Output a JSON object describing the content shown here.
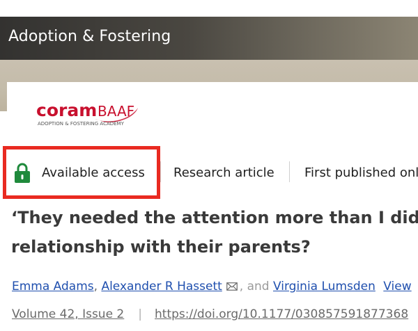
{
  "journal": {
    "title": "Adoption & Fostering"
  },
  "logo": {
    "brand_main": "coram",
    "brand_suffix": "BAAF",
    "tagline": "ADOPTION & FOSTERING ACADEMY"
  },
  "article_meta": {
    "access_label": "Available access",
    "article_type": "Research article",
    "first_published": "First published onl"
  },
  "article": {
    "title_line1": "‘They needed the attention more than I did’:",
    "title_line2": "relationship with their parents?"
  },
  "authors": {
    "author1": "Emma Adams",
    "author2": "Alexander R Hassett",
    "and_text": ", and",
    "author3": "Virginia Lumsden",
    "view_link": "View"
  },
  "publication": {
    "volume": "Volume 42, Issue 2",
    "doi": "https://doi.org/10.1177/030857591877368"
  },
  "colors": {
    "highlight": "#e92a21",
    "lock_green": "#1f8a3c",
    "link": "#1f4fae",
    "brand_red": "#c8102e"
  },
  "icons": {
    "lock": "lock-icon",
    "mail": "mail-icon"
  }
}
